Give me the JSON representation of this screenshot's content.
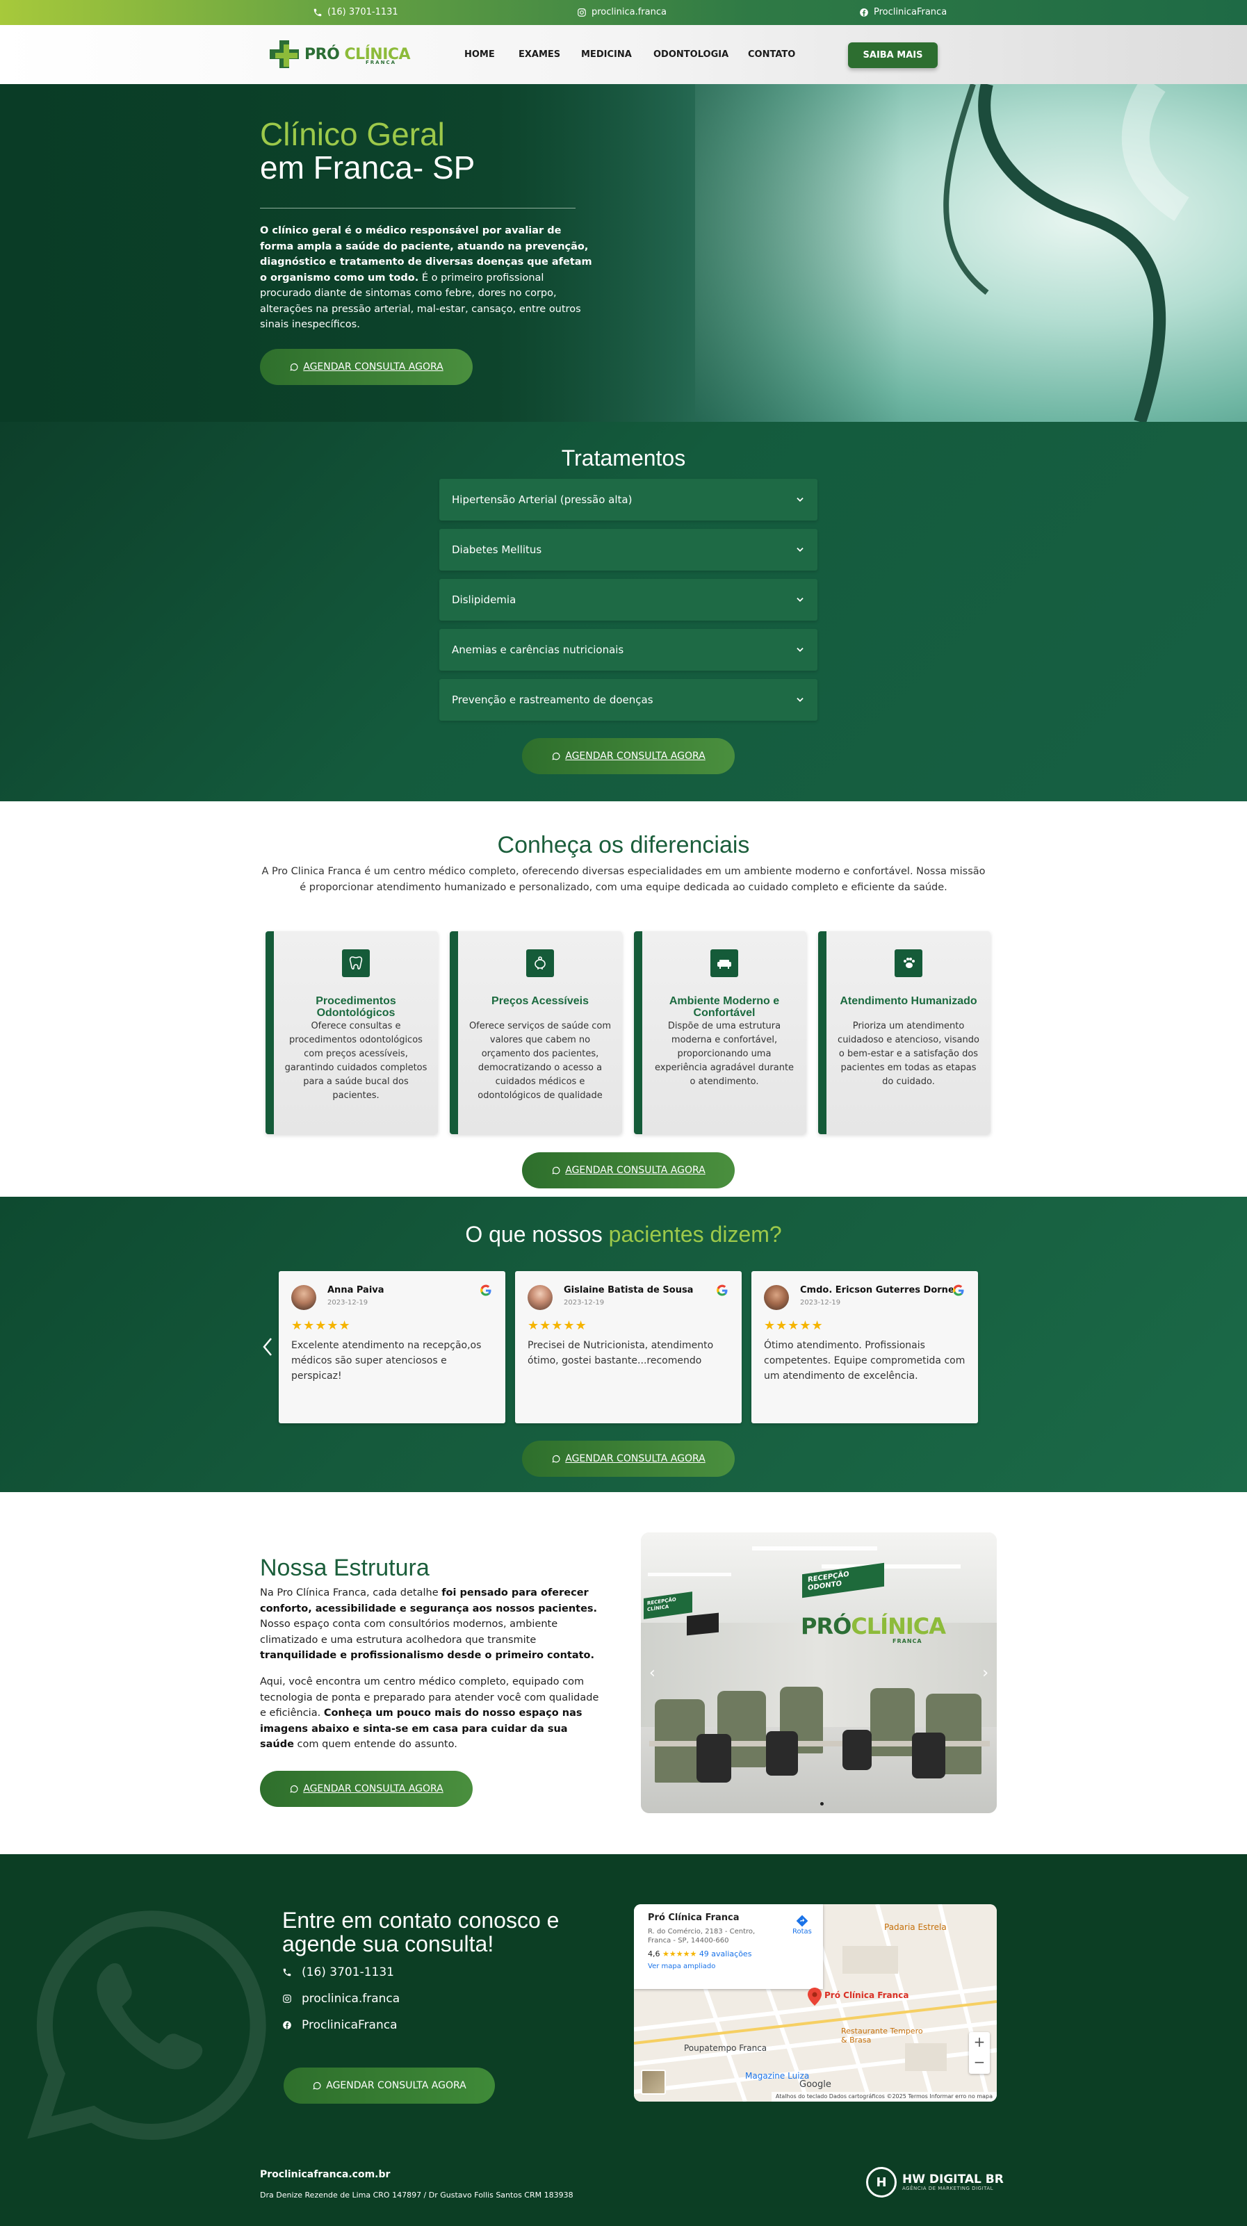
{
  "topbar": {
    "phone": "(16) 3701-1131",
    "instagram": "proclinica.franca",
    "facebook": "ProclinicaFranca"
  },
  "header": {
    "logo_main_a": "PRÓ",
    "logo_main_b": "CLÍNICA",
    "logo_sub": "FRANCA",
    "nav": [
      "HOME",
      "EXAMES",
      "MEDICINA",
      "ODONTOLOGIA",
      "CONTATO"
    ],
    "cta": "SAIBA MAIS"
  },
  "hero": {
    "title_line1": "Clínico Geral",
    "title_line2": "em Franca- SP",
    "text_bold": "O clínico geral é o médico responsável por avaliar de forma ampla a saúde do paciente, atuando na prevenção, diagnóstico e tratamento de diversas doenças que afetam o organismo como um todo.",
    "text_regular": " É o primeiro profissional procurado diante de sintomas como febre, dores no corpo, alterações na pressão arterial, mal-estar, cansaço, entre outros sinais inespecíficos.",
    "cta": "AGENDAR CONSULTA AGORA"
  },
  "treatments": {
    "title": "Tratamentos",
    "items": [
      "Hipertensão Arterial (pressão alta)",
      "Diabetes Mellitus",
      "Dislipidemia",
      "Anemias e carências nutricionais",
      "Prevenção e rastreamento de doenças"
    ],
    "cta": "AGENDAR CONSULTA AGORA"
  },
  "differentials": {
    "title": "Conheça os diferenciais",
    "intro": "A Pro Clinica Franca é um centro médico completo, oferecendo diversas especialidades em um ambiente moderno e confortável. Nossa missão é proporcionar atendimento humanizado e personalizado, com uma equipe dedicada ao cuidado completo e eficiente da saúde.",
    "cards": [
      {
        "icon": "tooth-icon",
        "title": "Procedimentos Odontológicos",
        "text": "Oferece consultas e procedimentos odontológicos com preços acessíveis, garantindo cuidados completos para a saúde bucal dos pacientes."
      },
      {
        "icon": "piggy-bank-icon",
        "title": "Preços Acessíveis",
        "text": "Oferece serviços de saúde com valores que cabem no orçamento dos pacientes, democratizando o acesso a cuidados médicos e odontológicos de qualidade"
      },
      {
        "icon": "couch-icon",
        "title": "Ambiente Moderno e Confortável",
        "text": "Dispõe de uma estrutura moderna e confortável, proporcionando uma experiência agradável durante o atendimento."
      },
      {
        "icon": "paw-icon",
        "title": "Atendimento Humanizado",
        "text": "Prioriza um atendimento cuidadoso e atencioso, visando o bem-estar e a satisfação dos pacientes em todas as etapas do cuidado."
      }
    ],
    "cta": "AGENDAR CONSULTA AGORA"
  },
  "testimonials": {
    "title_a": "O que nossos ",
    "title_b": "pacientes dizem?",
    "reviews": [
      {
        "name": "Anna Paiva",
        "date": "2023-12-19",
        "stars": "★★★★★",
        "text": "Excelente atendimento na recepção,os médicos são super atenciosos e perspicaz!"
      },
      {
        "name": "Gislaine Batista de Sousa",
        "date": "2023-12-19",
        "stars": "★★★★★",
        "text": "Precisei de Nutricionista, atendimento ótimo, gostei bastante...recomendo"
      },
      {
        "name": "Cmdo. Ericson Guterres Dorne...",
        "date": "2023-12-19",
        "stars": "★★★★★",
        "text": "Ótimo atendimento. Profissionais competentes. Equipe comprometida com um atendimento de excelência."
      }
    ],
    "cta": "AGENDAR CONSULTA AGORA"
  },
  "structure": {
    "title": "Nossa Estrutura",
    "p1_a": "Na Pro Clínica Franca, cada detalhe ",
    "p1_b": "foi pensado para oferecer conforto, acessibilidade e segurança aos nossos pacientes.",
    "p1_c": " Nosso espaço conta com consultórios modernos, ambiente climatizado e uma estrutura acolhedora que transmite ",
    "p1_d": "tranquilidade e profissionalismo desde o primeiro contato.",
    "p2_a": "Aqui, você encontra um centro médico completo, equipado com tecnologia de ponta e preparado para atender você com qualidade e eficiência. ",
    "p2_b": "Conheça um pouco mais do nosso espaço nas imagens abaixo e sinta-se em casa para cuidar da sua saúde",
    "p2_c": " com quem entende do assunto.",
    "cta": "AGENDAR CONSULTA AGORA",
    "photo_sign": "RECEPÇÃO ODONTO",
    "photo_sign2": "RECEPÇÃO CLÍNICA",
    "photo_logo_a": "PRÓ",
    "photo_logo_b": "CLÍNICA",
    "photo_logo_sub": "FRANCA"
  },
  "contact": {
    "title": "Entre em contato conosco e agende sua consulta!",
    "phone": "(16) 3701-1131",
    "instagram": "proclinica.franca",
    "facebook": "ProclinicaFranca",
    "cta": "AGENDAR CONSULTA AGORA",
    "map": {
      "place": "Pró Clínica Franca",
      "address": "R. do Comércio, 2183 - Centro, Franca - SP, 14400-660",
      "rating": "4,6",
      "stars": "★★★★★",
      "reviews": "49 avaliações",
      "link": "Ver mapa ampliado",
      "directions": "Rotas",
      "pin_label": "Pró Clínica Franca",
      "label_padaria": "Padaria Estrela",
      "label_poupatempo": "Poupatempo Franca",
      "label_restaurante": "Restaurante Tempero & Brasa",
      "label_magazine": "Magazine Luiza",
      "footer": "Atalhos do teclado   Dados cartográficos ©2025   Termos   Informar erro no mapa",
      "google": "Google"
    }
  },
  "footer": {
    "site": "Proclinicafranca.com.br",
    "doctors": "Dra Denize Rezende de Lima CRO 147897 / Dr Gustavo Follis Santos CRM 183938",
    "agency": "HW DIGITAL BR",
    "agency_sub": "AGÊNCIA DE MARKETING DIGITAL"
  },
  "colors": {
    "primary": "#155b39",
    "accent": "#9dc94a",
    "button": "#2d6e30"
  }
}
